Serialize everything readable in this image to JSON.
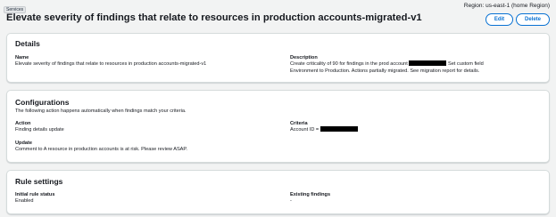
{
  "header": {
    "breadcrumb": "Services",
    "region": "Region: us-east-1 (home Region)",
    "title": "Elevate severity of findings that relate to resources in production accounts-migrated-v1",
    "edit_label": "Edit",
    "delete_label": "Delete"
  },
  "details": {
    "heading": "Details",
    "name_label": "Name",
    "name_value": "Elevate severity of findings that relate to resources in production accounts-migrated-v1",
    "description_label": "Description",
    "description_part1": "Create criticality of 90 for findings in the prod account",
    "description_part2": "Set custom field",
    "description_line2": "Environment to Production. Actions partially migrated. See migration report for details."
  },
  "configurations": {
    "heading": "Configurations",
    "subtitle": "The following action happens automatically when findings match your criteria.",
    "action_label": "Action",
    "action_value": "Finding details update",
    "criteria_label": "Criteria",
    "criteria_prefix": "Account ID =",
    "update_label": "Update",
    "update_value": "Comment to A resource in production accounts is at risk. Please review ASAP."
  },
  "rule_settings": {
    "heading": "Rule settings",
    "initial_status_label": "Initial rule status",
    "initial_status_value": "Enabled",
    "existing_findings_label": "Existing findings",
    "existing_findings_value": "-"
  }
}
